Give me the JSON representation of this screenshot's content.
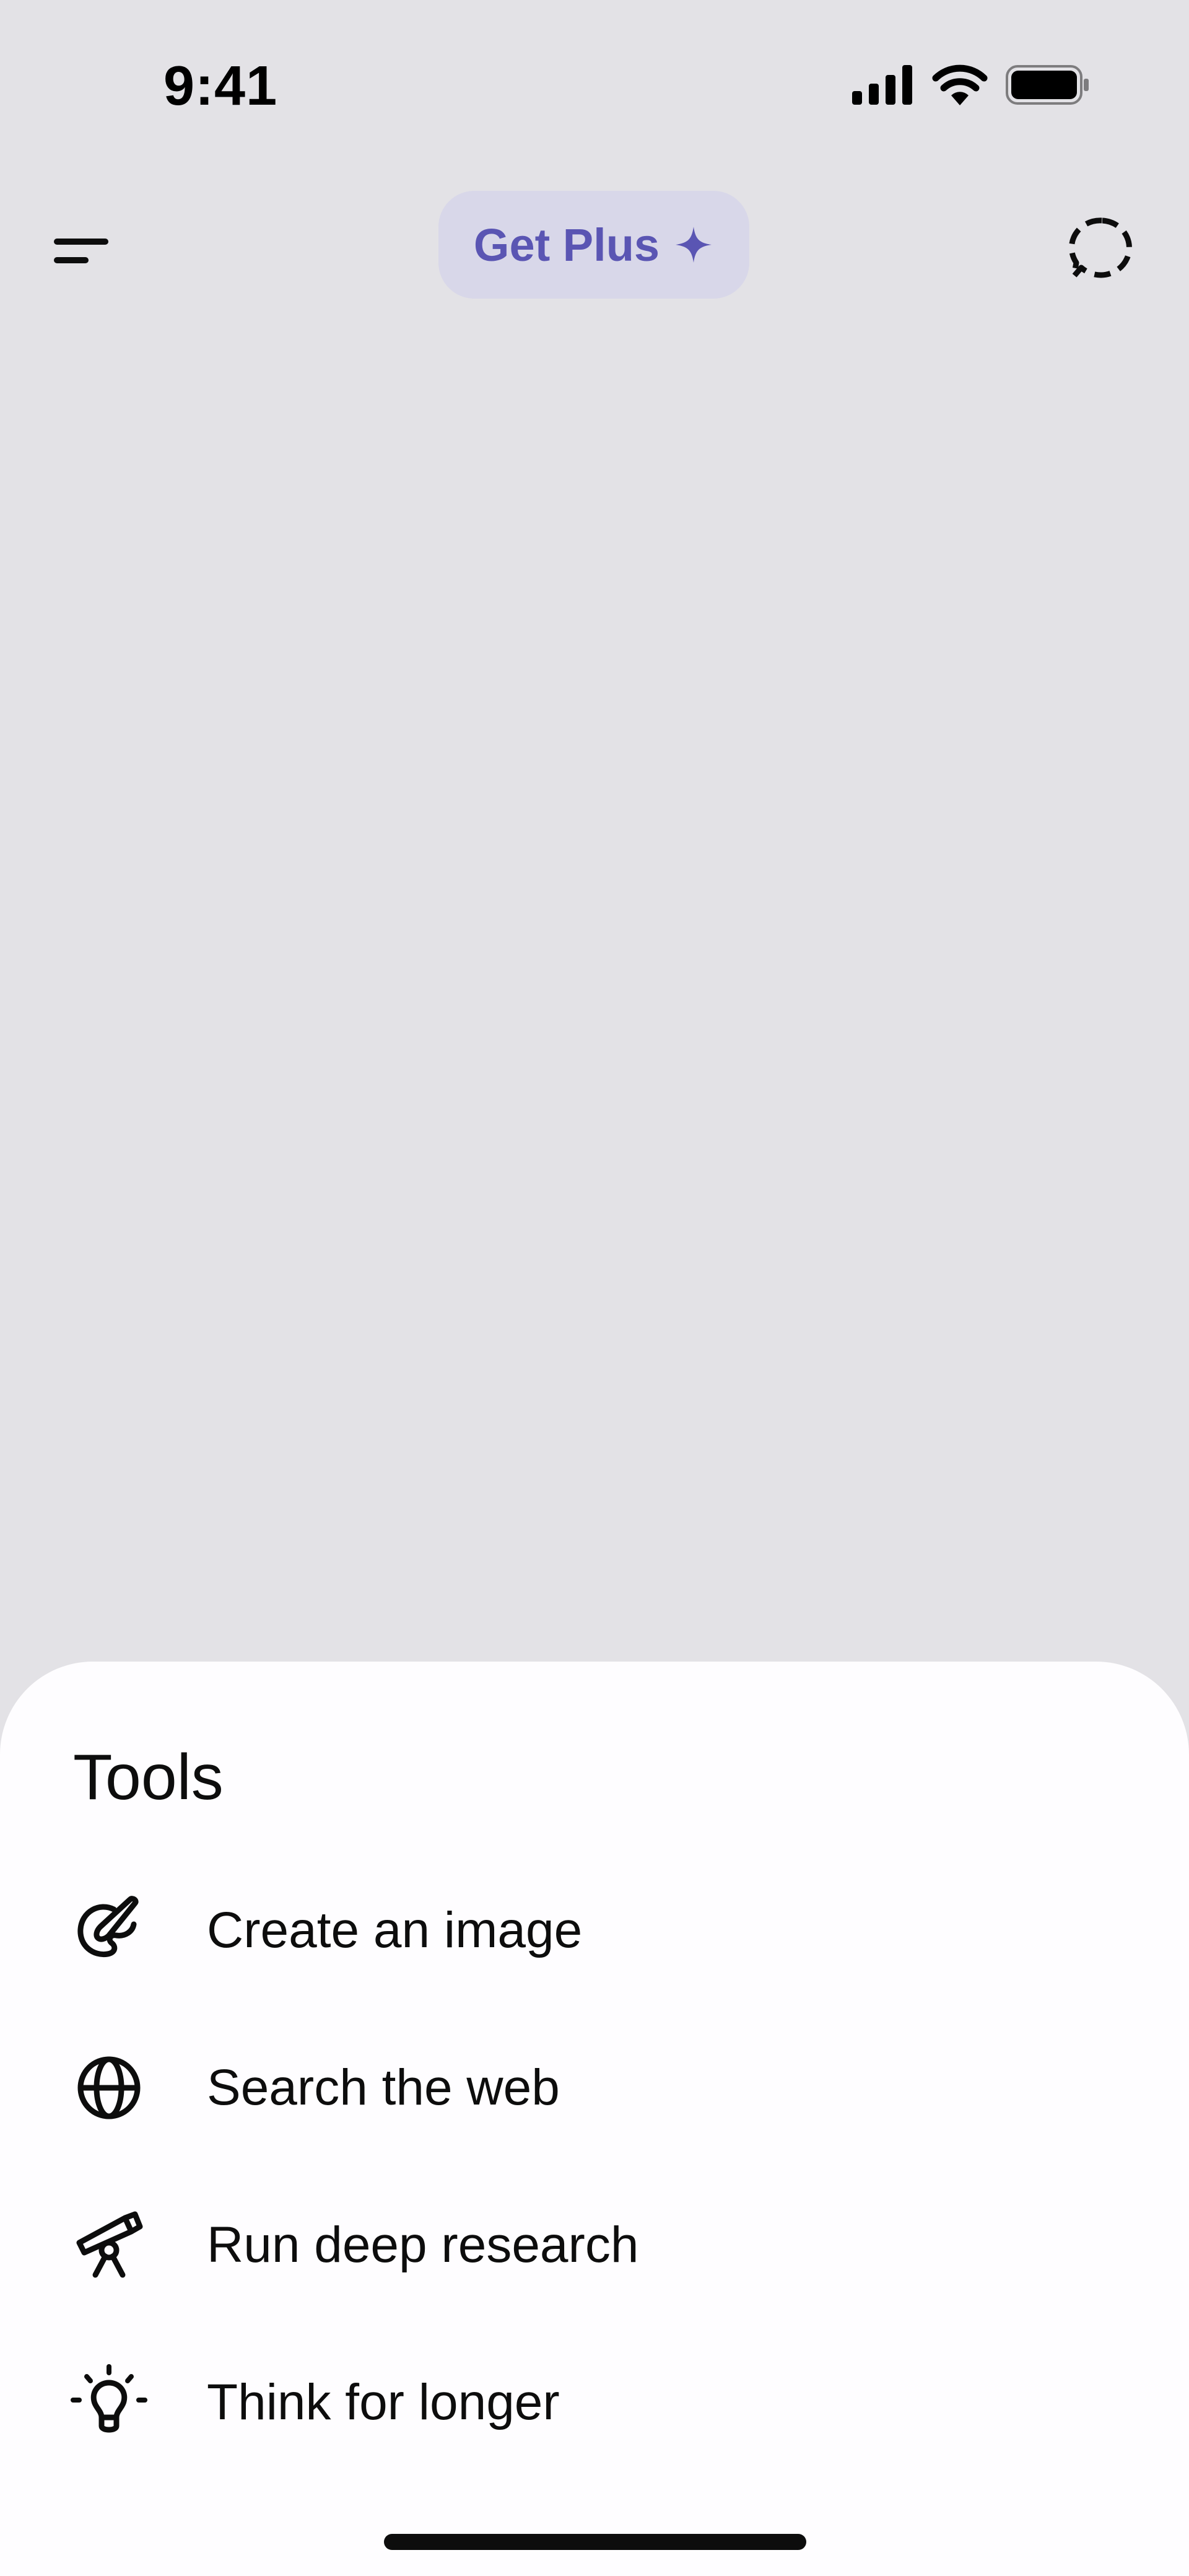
{
  "status_bar": {
    "time": "9:41",
    "icons": [
      "cellular-signal-icon",
      "wifi-icon",
      "battery-icon"
    ]
  },
  "top_bar": {
    "menu_icon": "menu-icon",
    "plus_button_label": "Get Plus",
    "plus_icon": "sparkle-icon",
    "chat_icon": "temporary-chat-icon",
    "accent_color": "#5a55b3"
  },
  "tools_sheet": {
    "title": "Tools",
    "items": [
      {
        "label": "Create an image",
        "icon": "paintbrush-icon"
      },
      {
        "label": "Search the web",
        "icon": "globe-icon"
      },
      {
        "label": "Run deep research",
        "icon": "telescope-icon"
      },
      {
        "label": "Think for longer",
        "icon": "lightbulb-icon"
      }
    ]
  }
}
